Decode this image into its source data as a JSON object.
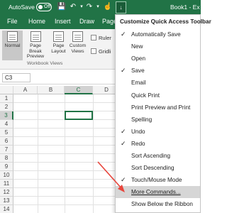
{
  "titlebar": {
    "autosave_label": "AutoSave",
    "toggle_text": "Off",
    "doc_title": "Book1 - Ex",
    "dropdown_glyph": "↓"
  },
  "tabs": [
    "File",
    "Home",
    "Insert",
    "Draw",
    "Page"
  ],
  "ribbon": {
    "buttons": [
      "Normal",
      "Page Break Preview",
      "Page Layout",
      "Custom Views"
    ],
    "checkboxes": [
      "Ruler",
      "Gridli"
    ],
    "group_label": "Workbook Views"
  },
  "formula": {
    "namebox": "C3"
  },
  "grid": {
    "columns": [
      "A",
      "B",
      "C",
      "D"
    ],
    "rows": [
      "1",
      "2",
      "3",
      "4",
      "5",
      "6",
      "7",
      "8",
      "9",
      "10",
      "11",
      "12",
      "13",
      "14"
    ],
    "selected_col": "C",
    "selected_row": "3"
  },
  "menu": {
    "title": "Customize Quick Access Toolbar",
    "items": [
      {
        "label": "Automatically Save",
        "checked": true
      },
      {
        "label": "New",
        "checked": false
      },
      {
        "label": "Open",
        "checked": false
      },
      {
        "label": "Save",
        "checked": true
      },
      {
        "label": "Email",
        "checked": false
      },
      {
        "label": "Quick Print",
        "checked": false
      },
      {
        "label": "Print Preview and Print",
        "checked": false
      },
      {
        "label": "Spelling",
        "checked": false
      },
      {
        "label": "Undo",
        "checked": true
      },
      {
        "label": "Redo",
        "checked": true
      },
      {
        "label": "Sort Ascending",
        "checked": false
      },
      {
        "label": "Sort Descending",
        "checked": false
      },
      {
        "label": "Touch/Mouse Mode",
        "checked": true
      },
      {
        "label": "More Commands...",
        "checked": false,
        "highlighted": true
      },
      {
        "label": "Show Below the Ribbon",
        "checked": false
      }
    ]
  },
  "colors": {
    "excel_green": "#217346",
    "annotation_arrow": "#e8453c"
  }
}
